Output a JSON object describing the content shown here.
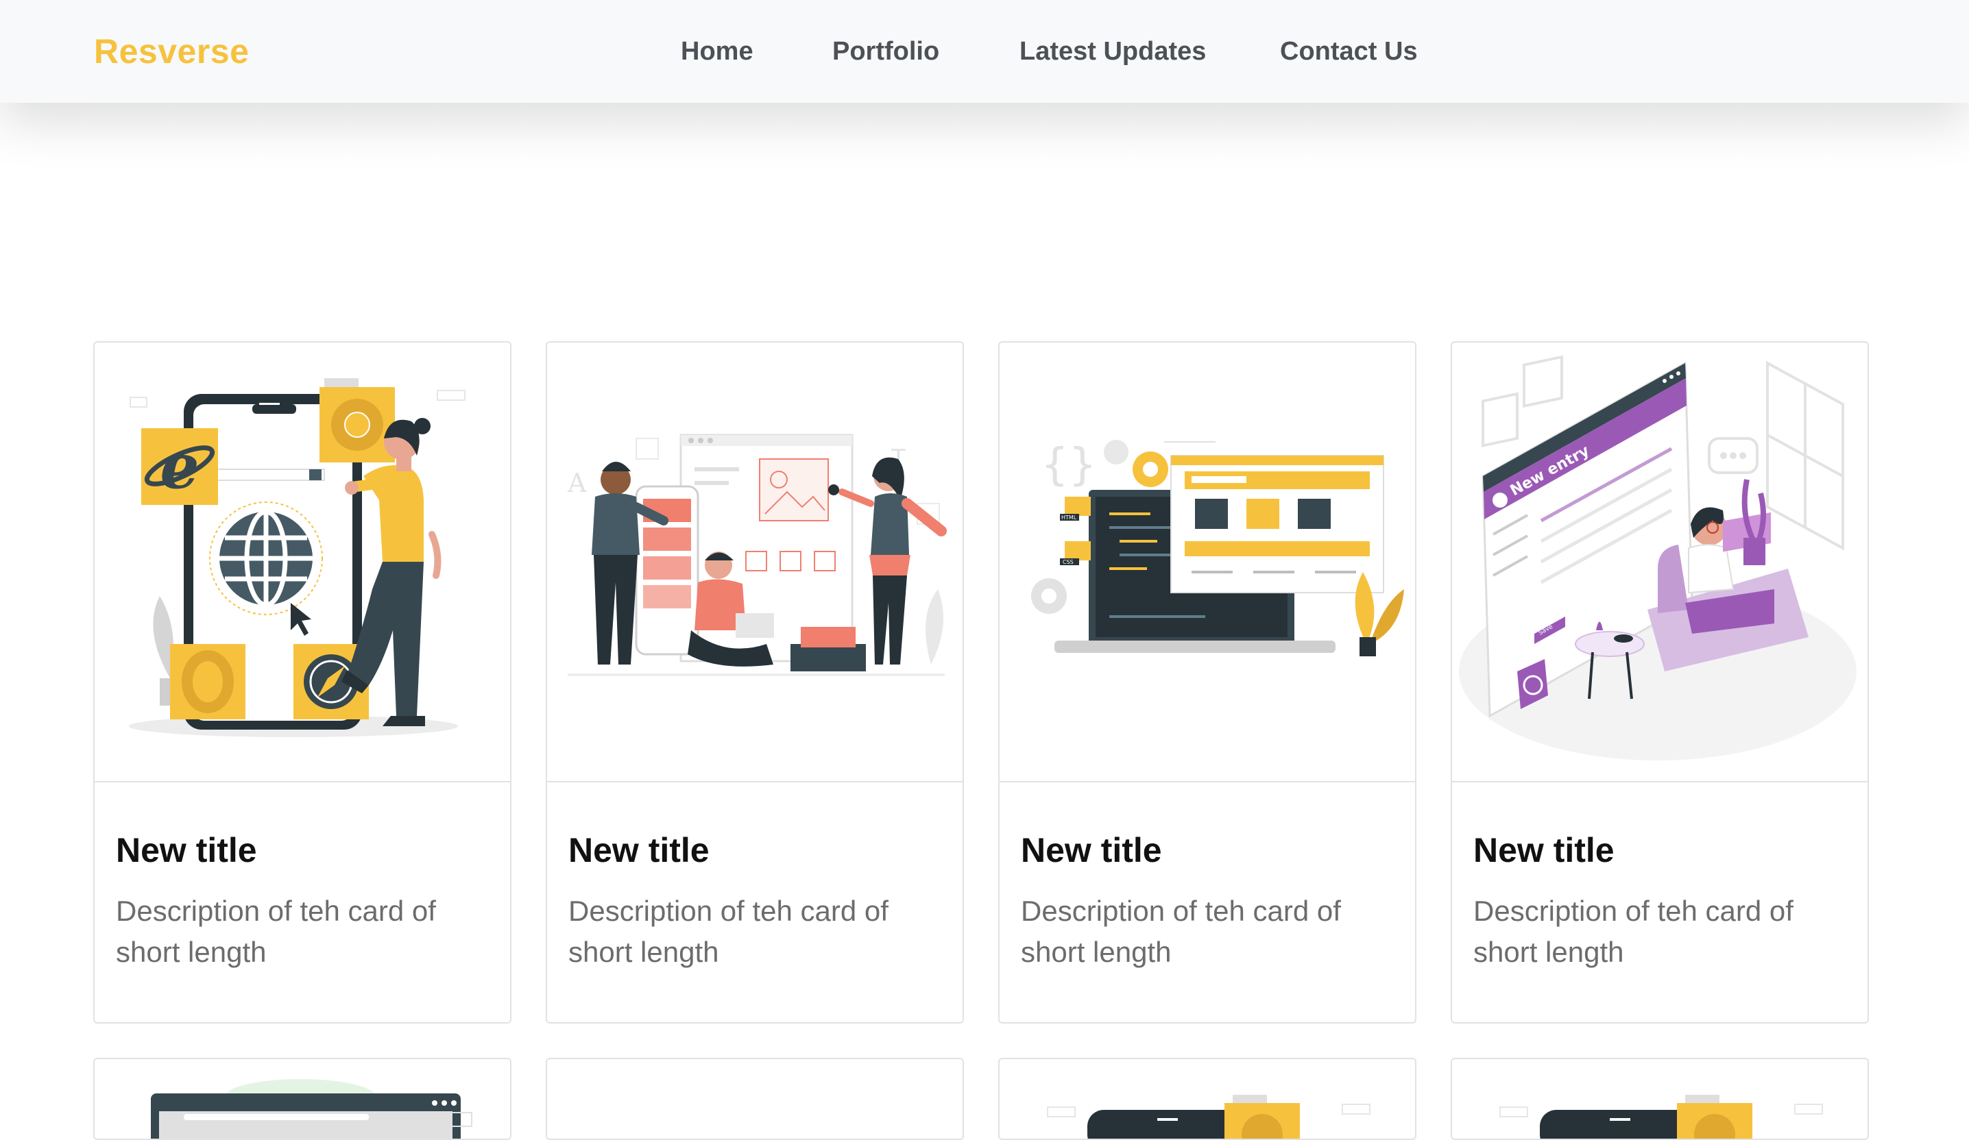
{
  "brand": {
    "name": "Resverse",
    "color": "#f6c23e"
  },
  "nav": {
    "items": [
      {
        "label": "Home"
      },
      {
        "label": "Portfolio"
      },
      {
        "label": "Latest Updates"
      },
      {
        "label": "Contact Us"
      }
    ]
  },
  "cards": [
    {
      "title": "New title",
      "description": "Description of teh card of short length",
      "illustration": "browser-icons-illustration"
    },
    {
      "title": "New title",
      "description": "Description of teh card of short length",
      "illustration": "team-design-illustration"
    },
    {
      "title": "New title",
      "description": "Description of teh card of short length",
      "illustration": "web-development-illustration"
    },
    {
      "title": "New title",
      "description": "Description of teh card of short length",
      "illustration": "new-entry-illustration"
    }
  ],
  "illustration_text": {
    "new_entry": "New entry",
    "html": "HTML",
    "css": "CSS",
    "save": "Save"
  },
  "colors": {
    "accent": "#f6c23e",
    "purple": "#9b59b6",
    "coral": "#f07f6e",
    "dark": "#37474f"
  }
}
